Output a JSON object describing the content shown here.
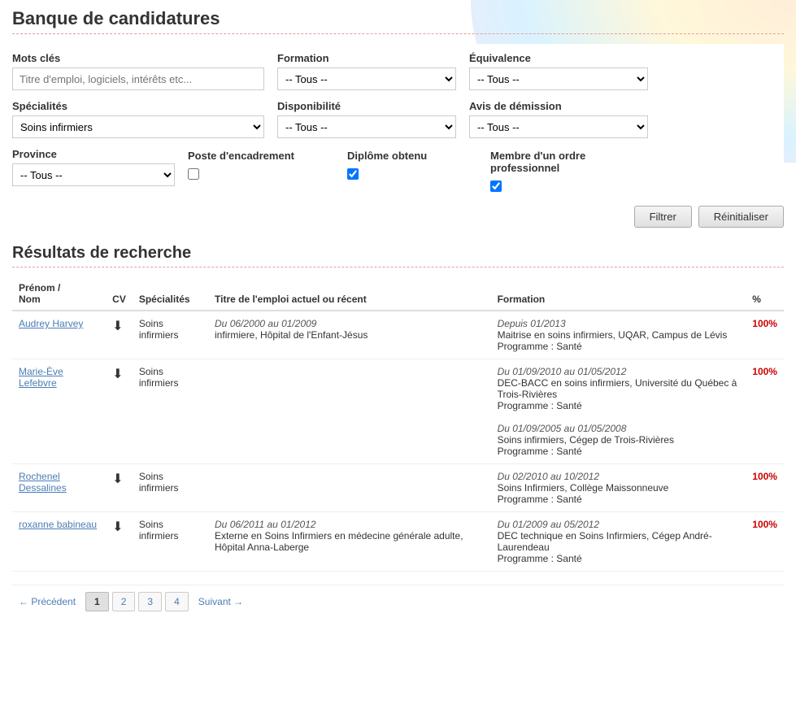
{
  "page": {
    "title": "Banque de candidatures"
  },
  "search": {
    "mots_cles_label": "Mots clés",
    "mots_cles_placeholder": "Titre d'emploi, logiciels, intérêts etc...",
    "specialites_label": "Spécialités",
    "specialites_value": "Soins infirmiers",
    "formation_label": "Formation",
    "formation_value": "-- Tous --",
    "equivalence_label": "Équivalence",
    "equivalence_value": "-- Tous --",
    "disponibilite_label": "Disponibilité",
    "disponibilite_value": "-- Tous --",
    "avis_label": "Avis de démission",
    "avis_value": "-- Tous --",
    "province_label": "Province",
    "province_value": "-- Tous --",
    "poste_label": "Poste d'encadrement",
    "diplome_label": "Diplôme obtenu",
    "membre_label": "Membre d'un ordre professionnel",
    "btn_filtrer": "Filtrer",
    "btn_reinitialiser": "Réinitialiser"
  },
  "results": {
    "section_title": "Résultats de recherche",
    "columns": {
      "prenom_nom": "Prénom /\nNom",
      "cv": "CV",
      "specialites": "Spécialités",
      "titre_emploi": "Titre de l'emploi actuel ou récent",
      "formation": "Formation",
      "pct": "%"
    },
    "rows": [
      {
        "name": "Audrey Harvey",
        "specialite": "Soins infirmiers",
        "job_date": "Du 06/2000 au 01/2009",
        "job_title": "infirmiere, Hôpital de l'Enfant-Jésus",
        "formation_date1": "Depuis 01/2013",
        "formation_detail1": "Maitrise en soins infirmiers, UQAR, Campus de Lévis",
        "formation_prog1": "Programme : Santé",
        "pct": "100%"
      },
      {
        "name": "Marie-Ève Lefebvre",
        "specialite": "Soins infirmiers",
        "job_date": "",
        "job_title": "",
        "formation_date1": "Du 01/09/2010 au 01/05/2012",
        "formation_detail1": "DEC-BACC en soins infirmiers, Université du Québec à Trois-Rivières",
        "formation_prog1": "Programme : Santé",
        "formation_date2": "Du 01/09/2005 au 01/05/2008",
        "formation_detail2": "Soins infirmiers, Cégep de Trois-Rivières",
        "formation_prog2": "Programme : Santé",
        "pct": "100%"
      },
      {
        "name": "Rochenel Dessalines",
        "specialite": "Soins infirmiers",
        "job_date": "",
        "job_title": "",
        "formation_date1": "Du 02/2010 au 10/2012",
        "formation_detail1": "Soins Infirmiers, Collège Maissonneuve",
        "formation_prog1": "Programme : Santé",
        "pct": "100%"
      },
      {
        "name": "roxanne babineau",
        "specialite": "Soins infirmiers",
        "job_date": "Du 06/2011 au 01/2012",
        "job_title": "Externe en Soins Infirmiers en médecine générale adulte, Hôpital Anna-Laberge",
        "formation_date1": "Du 01/2009 au 05/2012",
        "formation_detail1": "DEC technique en Soins Infirmiers, Cégep André-Laurendeau",
        "formation_prog1": "Programme : Santé",
        "pct": "100%"
      }
    ]
  },
  "pagination": {
    "prev": "← Précédent",
    "next": "Suivant →",
    "pages": [
      "1",
      "2",
      "3",
      "4"
    ],
    "active_page": "1"
  }
}
